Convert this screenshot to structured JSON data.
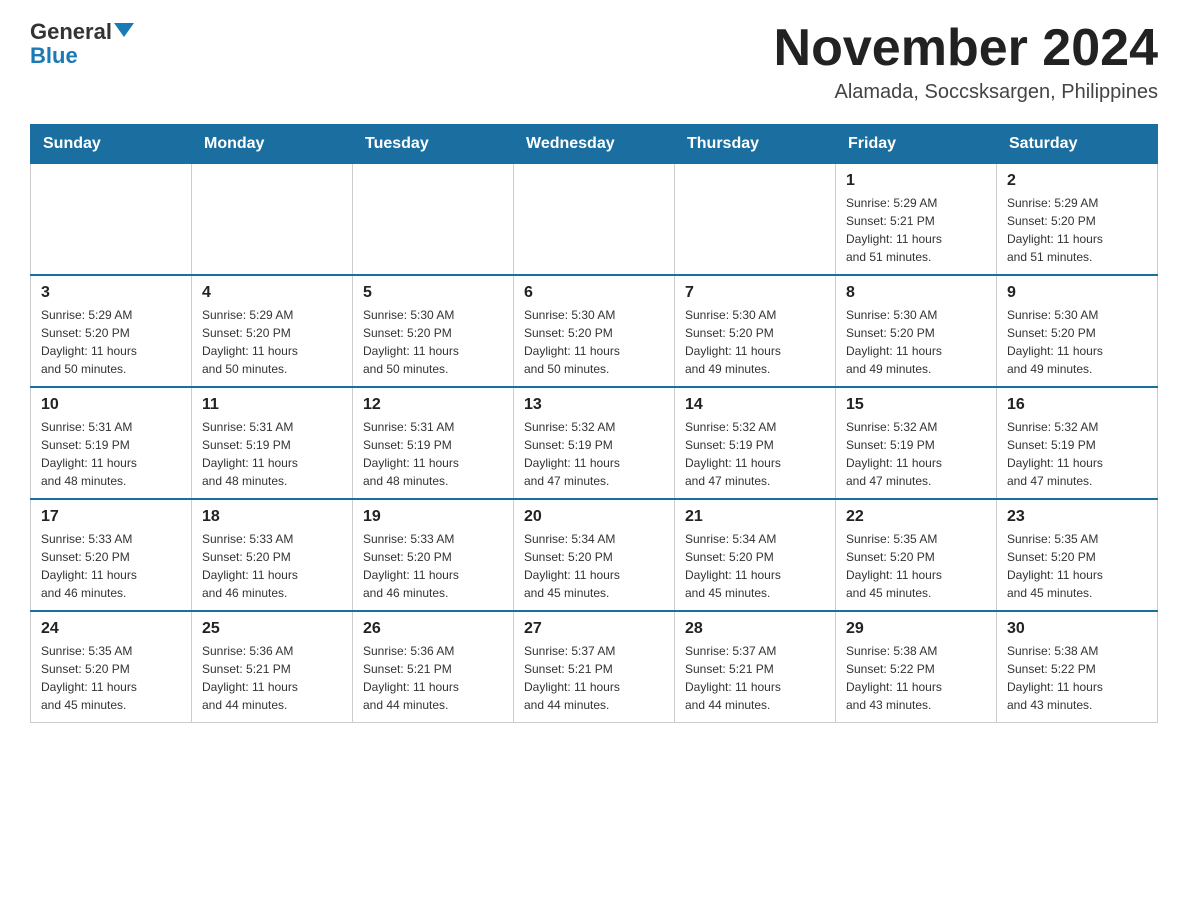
{
  "header": {
    "logo_general": "General",
    "logo_blue": "Blue",
    "month_title": "November 2024",
    "location": "Alamada, Soccsksargen, Philippines"
  },
  "days_of_week": [
    "Sunday",
    "Monday",
    "Tuesday",
    "Wednesday",
    "Thursday",
    "Friday",
    "Saturday"
  ],
  "weeks": [
    [
      {
        "day": "",
        "info": ""
      },
      {
        "day": "",
        "info": ""
      },
      {
        "day": "",
        "info": ""
      },
      {
        "day": "",
        "info": ""
      },
      {
        "day": "",
        "info": ""
      },
      {
        "day": "1",
        "info": "Sunrise: 5:29 AM\nSunset: 5:21 PM\nDaylight: 11 hours\nand 51 minutes."
      },
      {
        "day": "2",
        "info": "Sunrise: 5:29 AM\nSunset: 5:20 PM\nDaylight: 11 hours\nand 51 minutes."
      }
    ],
    [
      {
        "day": "3",
        "info": "Sunrise: 5:29 AM\nSunset: 5:20 PM\nDaylight: 11 hours\nand 50 minutes."
      },
      {
        "day": "4",
        "info": "Sunrise: 5:29 AM\nSunset: 5:20 PM\nDaylight: 11 hours\nand 50 minutes."
      },
      {
        "day": "5",
        "info": "Sunrise: 5:30 AM\nSunset: 5:20 PM\nDaylight: 11 hours\nand 50 minutes."
      },
      {
        "day": "6",
        "info": "Sunrise: 5:30 AM\nSunset: 5:20 PM\nDaylight: 11 hours\nand 50 minutes."
      },
      {
        "day": "7",
        "info": "Sunrise: 5:30 AM\nSunset: 5:20 PM\nDaylight: 11 hours\nand 49 minutes."
      },
      {
        "day": "8",
        "info": "Sunrise: 5:30 AM\nSunset: 5:20 PM\nDaylight: 11 hours\nand 49 minutes."
      },
      {
        "day": "9",
        "info": "Sunrise: 5:30 AM\nSunset: 5:20 PM\nDaylight: 11 hours\nand 49 minutes."
      }
    ],
    [
      {
        "day": "10",
        "info": "Sunrise: 5:31 AM\nSunset: 5:19 PM\nDaylight: 11 hours\nand 48 minutes."
      },
      {
        "day": "11",
        "info": "Sunrise: 5:31 AM\nSunset: 5:19 PM\nDaylight: 11 hours\nand 48 minutes."
      },
      {
        "day": "12",
        "info": "Sunrise: 5:31 AM\nSunset: 5:19 PM\nDaylight: 11 hours\nand 48 minutes."
      },
      {
        "day": "13",
        "info": "Sunrise: 5:32 AM\nSunset: 5:19 PM\nDaylight: 11 hours\nand 47 minutes."
      },
      {
        "day": "14",
        "info": "Sunrise: 5:32 AM\nSunset: 5:19 PM\nDaylight: 11 hours\nand 47 minutes."
      },
      {
        "day": "15",
        "info": "Sunrise: 5:32 AM\nSunset: 5:19 PM\nDaylight: 11 hours\nand 47 minutes."
      },
      {
        "day": "16",
        "info": "Sunrise: 5:32 AM\nSunset: 5:19 PM\nDaylight: 11 hours\nand 47 minutes."
      }
    ],
    [
      {
        "day": "17",
        "info": "Sunrise: 5:33 AM\nSunset: 5:20 PM\nDaylight: 11 hours\nand 46 minutes."
      },
      {
        "day": "18",
        "info": "Sunrise: 5:33 AM\nSunset: 5:20 PM\nDaylight: 11 hours\nand 46 minutes."
      },
      {
        "day": "19",
        "info": "Sunrise: 5:33 AM\nSunset: 5:20 PM\nDaylight: 11 hours\nand 46 minutes."
      },
      {
        "day": "20",
        "info": "Sunrise: 5:34 AM\nSunset: 5:20 PM\nDaylight: 11 hours\nand 45 minutes."
      },
      {
        "day": "21",
        "info": "Sunrise: 5:34 AM\nSunset: 5:20 PM\nDaylight: 11 hours\nand 45 minutes."
      },
      {
        "day": "22",
        "info": "Sunrise: 5:35 AM\nSunset: 5:20 PM\nDaylight: 11 hours\nand 45 minutes."
      },
      {
        "day": "23",
        "info": "Sunrise: 5:35 AM\nSunset: 5:20 PM\nDaylight: 11 hours\nand 45 minutes."
      }
    ],
    [
      {
        "day": "24",
        "info": "Sunrise: 5:35 AM\nSunset: 5:20 PM\nDaylight: 11 hours\nand 45 minutes."
      },
      {
        "day": "25",
        "info": "Sunrise: 5:36 AM\nSunset: 5:21 PM\nDaylight: 11 hours\nand 44 minutes."
      },
      {
        "day": "26",
        "info": "Sunrise: 5:36 AM\nSunset: 5:21 PM\nDaylight: 11 hours\nand 44 minutes."
      },
      {
        "day": "27",
        "info": "Sunrise: 5:37 AM\nSunset: 5:21 PM\nDaylight: 11 hours\nand 44 minutes."
      },
      {
        "day": "28",
        "info": "Sunrise: 5:37 AM\nSunset: 5:21 PM\nDaylight: 11 hours\nand 44 minutes."
      },
      {
        "day": "29",
        "info": "Sunrise: 5:38 AM\nSunset: 5:22 PM\nDaylight: 11 hours\nand 43 minutes."
      },
      {
        "day": "30",
        "info": "Sunrise: 5:38 AM\nSunset: 5:22 PM\nDaylight: 11 hours\nand 43 minutes."
      }
    ]
  ]
}
